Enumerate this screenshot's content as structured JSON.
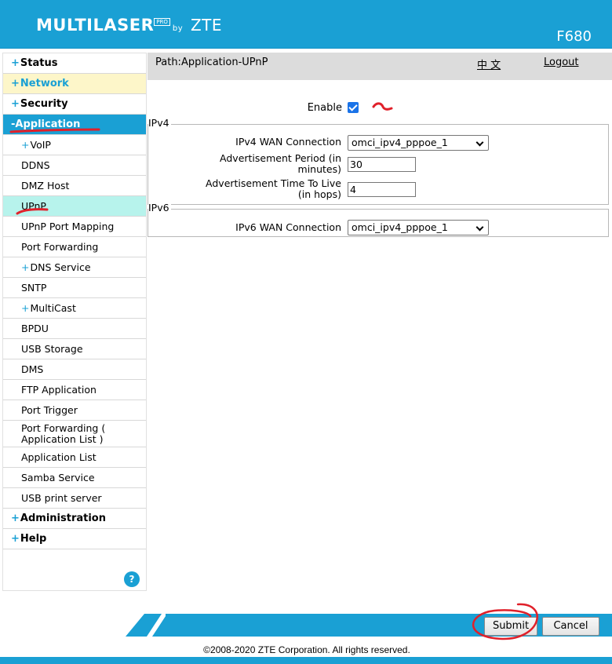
{
  "header": {
    "brand_main": "MULTILASER",
    "brand_tm": "PRO",
    "brand_by": "by",
    "brand_vendor": "ZTE",
    "model": "F680"
  },
  "sidebar": {
    "items": [
      {
        "label": "Status",
        "sign": "+"
      },
      {
        "label": "Network",
        "sign": "+"
      },
      {
        "label": "Security",
        "sign": "+"
      },
      {
        "label": "Application",
        "sign": "-"
      }
    ],
    "sub_items": [
      {
        "label": "VoIP",
        "sign": "+"
      },
      {
        "label": "DDNS"
      },
      {
        "label": "DMZ Host"
      },
      {
        "label": "UPnP"
      },
      {
        "label": "UPnP Port Mapping"
      },
      {
        "label": "Port Forwarding"
      },
      {
        "label": "DNS Service",
        "sign": "+"
      },
      {
        "label": "SNTP"
      },
      {
        "label": "MultiCast",
        "sign": "+"
      },
      {
        "label": "BPDU"
      },
      {
        "label": "USB Storage"
      },
      {
        "label": "DMS"
      },
      {
        "label": "FTP Application"
      },
      {
        "label": "Port Trigger"
      },
      {
        "label": "Port Forwarding ( Application List )"
      },
      {
        "label": "Application List"
      },
      {
        "label": "Samba Service"
      },
      {
        "label": "USB print server"
      }
    ],
    "bottom_items": [
      {
        "label": "Administration",
        "sign": "+"
      },
      {
        "label": "Help",
        "sign": "+"
      }
    ],
    "help_icon": "?"
  },
  "pathbar": {
    "path": "Path:Application-UPnP",
    "lang": "中 文",
    "logout": "Logout"
  },
  "form": {
    "enable_label": "Enable",
    "enable_checked": true,
    "ipv4_legend": "IPv4",
    "ipv4_wan_label": "IPv4 WAN Connection",
    "ipv4_wan_value": "omci_ipv4_pppoe_1",
    "adv_period_label_1": "Advertisement Period (in",
    "adv_period_label_2": "minutes)",
    "adv_period_value": "30",
    "adv_ttl_label_1": "Advertisement Time To Live",
    "adv_ttl_label_2": "(in hops)",
    "adv_ttl_value": "4",
    "ipv6_legend": "IPv6",
    "ipv6_wan_label": "IPv6 WAN Connection",
    "ipv6_wan_value": "omci_ipv4_pppoe_1"
  },
  "footer": {
    "submit": "Submit",
    "cancel": "Cancel",
    "copyright": "©2008-2020 ZTE Corporation. All rights reserved."
  },
  "colors": {
    "accent": "#1aa0d4",
    "selected_sub": "#b7f3ec",
    "network_bg": "#fdf6c9",
    "annotation": "#e0202a"
  }
}
